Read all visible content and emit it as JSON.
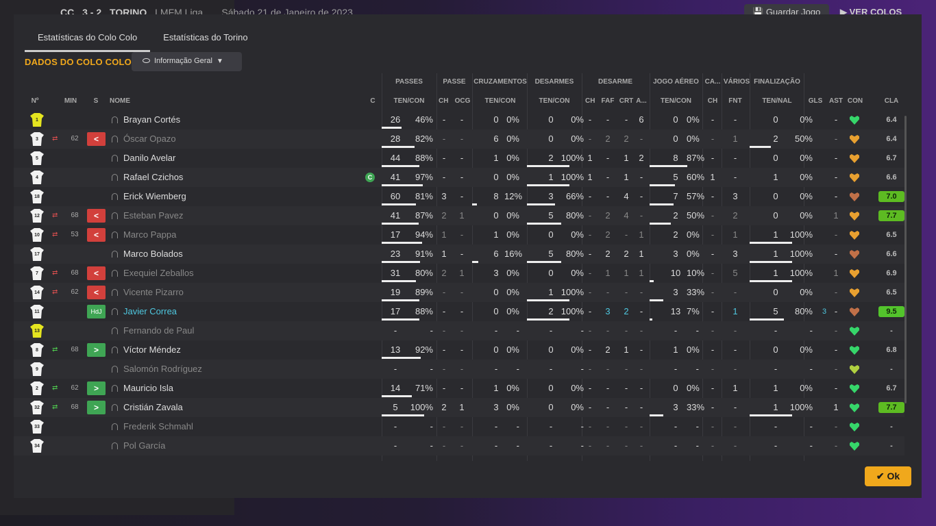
{
  "header": {
    "back_icon": "arrow-left-icon",
    "home_abbr": "CC",
    "score": "3 - 2",
    "away": "TORINO",
    "competition": "LMFM Liga",
    "date": "Sábado 21 de Janeiro de 2023",
    "save_label": "Guardar Jogo",
    "ver_label": "VER COLOS"
  },
  "tabs": [
    "Estatísticas do Colo Colo",
    "Estatísticas do Torino"
  ],
  "team_title": "DADOS DO COLO COLO",
  "dropdown": "Informação Geral",
  "groups": [
    "PASSES",
    "PASSE",
    "CRUZAMENTOS",
    "DESARMES",
    "DESARME",
    "JOGO AÉREO",
    "CA...",
    "VÁRIOS",
    "FINALIZAÇÃO"
  ],
  "columns": [
    "Nº",
    "MIN",
    "S",
    "NOME",
    "C",
    "TEN/CON",
    "CH",
    "OCG",
    "TEN/CON",
    "TEN/CON",
    "CH",
    "FAF",
    "CRT",
    "A...",
    "TEN/CON",
    "CH",
    "FNT",
    "TEN/NAL",
    "GLS",
    "AST",
    "CON",
    "CLA"
  ],
  "colors": {
    "accent": "#f0a81c",
    "sub_out": "#d2403c",
    "sub_in": "#3fa554",
    "link": "#4fc8e0"
  },
  "players": [
    {
      "name": "Brayan Cortés",
      "num": "1",
      "gk": true,
      "cap": false,
      "swap": "",
      "min": "",
      "s": "",
      "p": [
        "26",
        "46%"
      ],
      "p2": [
        "-",
        "-"
      ],
      "cr": [
        "0",
        "0%"
      ],
      "de": [
        "0",
        "0%"
      ],
      "d2": [
        "-",
        "-",
        "-",
        "6"
      ],
      "ae": [
        "0",
        "0%"
      ],
      "ca": "-",
      "fnt": "-",
      "fi": [
        "0",
        "0%"
      ],
      "gls": "",
      "ast": "-",
      "con": "#36d66a",
      "cla": "6.4",
      "hl": false,
      "dim": false,
      "bars": {
        "p": 37,
        "cr": 0,
        "de": 0,
        "ae": 0,
        "fi": 0
      }
    },
    {
      "name": "Óscar Opazo",
      "num": "3",
      "gk": false,
      "cap": false,
      "swap": "out",
      "min": "62",
      "s": "red",
      "p": [
        "28",
        "82%"
      ],
      "p2": [
        "-",
        "-"
      ],
      "cr": [
        "6",
        "0%"
      ],
      "de": [
        "0",
        "0%"
      ],
      "d2": [
        "-",
        "2",
        "2",
        "-"
      ],
      "ae": [
        "0",
        "0%"
      ],
      "ca": "-",
      "fnt": "1",
      "fi": [
        "2",
        "50%"
      ],
      "gls": "",
      "ast": "-",
      "con": "#e8a030",
      "cla": "6.4",
      "hl": false,
      "dim": true,
      "bars": {
        "p": 62,
        "cr": 0,
        "de": 0,
        "ae": 0,
        "fi": 40
      }
    },
    {
      "name": "Danilo Avelar",
      "num": "5",
      "gk": false,
      "cap": false,
      "swap": "",
      "min": "",
      "s": "",
      "p": [
        "44",
        "88%"
      ],
      "p2": [
        "-",
        "-"
      ],
      "cr": [
        "1",
        "0%"
      ],
      "de": [
        "2",
        "100%"
      ],
      "d2": [
        "1",
        "-",
        "1",
        "2"
      ],
      "ae": [
        "8",
        "87%"
      ],
      "ca": "-",
      "fnt": "-",
      "fi": [
        "0",
        "0%"
      ],
      "gls": "",
      "ast": "-",
      "con": "#e8a030",
      "cla": "6.7",
      "hl": false,
      "dim": false,
      "bars": {
        "p": 70,
        "cr": 0,
        "de": 80,
        "ae": 70,
        "fi": 0
      }
    },
    {
      "name": "Rafael Czichos",
      "num": "4",
      "gk": false,
      "cap": true,
      "swap": "",
      "min": "",
      "s": "",
      "p": [
        "41",
        "97%"
      ],
      "p2": [
        "-",
        "-"
      ],
      "cr": [
        "0",
        "0%"
      ],
      "de": [
        "1",
        "100%"
      ],
      "d2": [
        "1",
        "-",
        "1",
        "-"
      ],
      "ae": [
        "5",
        "60%"
      ],
      "ca": "1",
      "fnt": "-",
      "fi": [
        "1",
        "0%"
      ],
      "gls": "",
      "ast": "-",
      "con": "#e8a030",
      "cla": "6.6",
      "hl": false,
      "dim": false,
      "bars": {
        "p": 77,
        "cr": 0,
        "de": 80,
        "ae": 48,
        "fi": 0
      }
    },
    {
      "name": "Erick Wiemberg",
      "num": "18",
      "gk": false,
      "cap": false,
      "swap": "",
      "min": "",
      "s": "",
      "p": [
        "60",
        "81%"
      ],
      "p2": [
        "3",
        "-"
      ],
      "cr": [
        "8",
        "12%"
      ],
      "de": [
        "3",
        "66%"
      ],
      "d2": [
        "-",
        "-",
        "4",
        "-"
      ],
      "ae": [
        "7",
        "57%"
      ],
      "ca": "-",
      "fnt": "3",
      "fi": [
        "0",
        "0%"
      ],
      "gls": "",
      "ast": "-",
      "con": "#c07048",
      "cla": "7.0",
      "hl": true,
      "dim": false,
      "bars": {
        "p": 64,
        "cr": 9,
        "de": 52,
        "ae": 45,
        "fi": 0
      }
    },
    {
      "name": "Esteban Pavez",
      "num": "12",
      "gk": false,
      "cap": false,
      "swap": "out",
      "min": "68",
      "s": "red",
      "p": [
        "41",
        "87%"
      ],
      "p2": [
        "2",
        "1"
      ],
      "cr": [
        "0",
        "0%"
      ],
      "de": [
        "5",
        "80%"
      ],
      "d2": [
        "-",
        "2",
        "4",
        "-"
      ],
      "ae": [
        "2",
        "50%"
      ],
      "ca": "-",
      "fnt": "2",
      "fi": [
        "0",
        "0%"
      ],
      "gls": "",
      "ast": "1",
      "con": "#e8a030",
      "cla": "7.7",
      "hl": true,
      "dim": true,
      "bars": {
        "p": 69,
        "cr": 0,
        "de": 64,
        "ae": 40,
        "fi": 0
      }
    },
    {
      "name": "Marco Pappa",
      "num": "10",
      "gk": false,
      "cap": false,
      "swap": "out",
      "min": "53",
      "s": "red",
      "p": [
        "17",
        "94%"
      ],
      "p2": [
        "1",
        "-"
      ],
      "cr": [
        "1",
        "0%"
      ],
      "de": [
        "0",
        "0%"
      ],
      "d2": [
        "-",
        "2",
        "-",
        "1"
      ],
      "ae": [
        "2",
        "0%"
      ],
      "ca": "-",
      "fnt": "1",
      "fi": [
        "1",
        "100%"
      ],
      "gls": "",
      "ast": "-",
      "con": "#e8a030",
      "cla": "6.5",
      "hl": false,
      "dim": true,
      "bars": {
        "p": 75,
        "cr": 0,
        "de": 0,
        "ae": 0,
        "fi": 80
      }
    },
    {
      "name": "Marco Bolados",
      "num": "17",
      "gk": false,
      "cap": false,
      "swap": "",
      "min": "",
      "s": "",
      "p": [
        "23",
        "91%"
      ],
      "p2": [
        "1",
        "-"
      ],
      "cr": [
        "6",
        "16%"
      ],
      "de": [
        "5",
        "80%"
      ],
      "d2": [
        "-",
        "2",
        "2",
        "1"
      ],
      "ae": [
        "3",
        "0%"
      ],
      "ca": "-",
      "fnt": "3",
      "fi": [
        "1",
        "100%"
      ],
      "gls": "",
      "ast": "-",
      "con": "#c07048",
      "cla": "6.6",
      "hl": false,
      "dim": false,
      "bars": {
        "p": 72,
        "cr": 12,
        "de": 64,
        "ae": 0,
        "fi": 80
      }
    },
    {
      "name": "Exequiel Zeballos",
      "num": "7",
      "gk": false,
      "cap": false,
      "swap": "out",
      "min": "68",
      "s": "red",
      "p": [
        "31",
        "80%"
      ],
      "p2": [
        "2",
        "1"
      ],
      "cr": [
        "3",
        "0%"
      ],
      "de": [
        "0",
        "0%"
      ],
      "d2": [
        "-",
        "1",
        "1",
        "1"
      ],
      "ae": [
        "10",
        "10%"
      ],
      "ca": "-",
      "fnt": "5",
      "fi": [
        "1",
        "100%"
      ],
      "gls": "",
      "ast": "1",
      "con": "#e8a030",
      "cla": "6.9",
      "hl": false,
      "dim": true,
      "bars": {
        "p": 64,
        "cr": 0,
        "de": 0,
        "ae": 8,
        "fi": 80
      }
    },
    {
      "name": "Vicente Pizarro",
      "num": "14",
      "gk": false,
      "cap": false,
      "swap": "out",
      "min": "62",
      "s": "red",
      "p": [
        "19",
        "89%"
      ],
      "p2": [
        "-",
        "-"
      ],
      "cr": [
        "0",
        "0%"
      ],
      "de": [
        "1",
        "100%"
      ],
      "d2": [
        "-",
        "-",
        "-",
        "-"
      ],
      "ae": [
        "3",
        "33%"
      ],
      "ca": "-",
      "fnt": "-",
      "fi": [
        "0",
        "0%"
      ],
      "gls": "",
      "ast": "-",
      "con": "#e8a030",
      "cla": "6.5",
      "hl": false,
      "dim": true,
      "bars": {
        "p": 71,
        "cr": 0,
        "de": 80,
        "ae": 26,
        "fi": 0
      }
    },
    {
      "name": "Javier Correa",
      "num": "11",
      "gk": false,
      "cap": false,
      "swap": "",
      "min": "",
      "s": "hdj",
      "s_label": "HdJ",
      "p": [
        "17",
        "88%"
      ],
      "p2": [
        "-",
        "-"
      ],
      "cr": [
        "0",
        "0%"
      ],
      "de": [
        "2",
        "100%"
      ],
      "d2": [
        "-",
        "3",
        "2",
        "-"
      ],
      "ae": [
        "13",
        "7%"
      ],
      "ca": "-",
      "fnt": "1",
      "fi": [
        "5",
        "80%"
      ],
      "gls": "3",
      "ast": "-",
      "con": "#c07048",
      "cla": "9.5",
      "hl": true,
      "dim": false,
      "link": true,
      "bars": {
        "p": 70,
        "cr": 0,
        "de": 80,
        "ae": 5,
        "fi": 64
      }
    },
    {
      "name": "Fernando de Paul",
      "num": "13",
      "gk": true,
      "cap": false,
      "swap": "",
      "min": "",
      "s": "",
      "p": [
        "-",
        "-"
      ],
      "p2": [
        "-",
        "-"
      ],
      "cr": [
        "-",
        "-"
      ],
      "de": [
        "-",
        "-"
      ],
      "d2": [
        "-",
        "-",
        "-",
        "-"
      ],
      "ae": [
        "-",
        "-"
      ],
      "ca": "-",
      "fnt": "-",
      "fi": [
        "-",
        "-"
      ],
      "gls": "",
      "ast": "-",
      "con": "#36d66a",
      "cla": "-",
      "hl": false,
      "dim": true,
      "bars": {
        "p": 0,
        "cr": 0,
        "de": 0,
        "ae": 0,
        "fi": 0
      }
    },
    {
      "name": "Víctor Méndez",
      "num": "8",
      "gk": false,
      "cap": false,
      "swap": "in",
      "min": "68",
      "s": "green",
      "p": [
        "13",
        "92%"
      ],
      "p2": [
        "-",
        "-"
      ],
      "cr": [
        "0",
        "0%"
      ],
      "de": [
        "0",
        "0%"
      ],
      "d2": [
        "-",
        "2",
        "1",
        "-"
      ],
      "ae": [
        "1",
        "0%"
      ],
      "ca": "-",
      "fnt": "-",
      "fi": [
        "0",
        "0%"
      ],
      "gls": "",
      "ast": "-",
      "con": "#36d66a",
      "cla": "6.8",
      "hl": false,
      "dim": false,
      "bars": {
        "p": 73,
        "cr": 0,
        "de": 0,
        "ae": 0,
        "fi": 0
      }
    },
    {
      "name": "Salomón Rodríguez",
      "num": "9",
      "gk": false,
      "cap": false,
      "swap": "",
      "min": "",
      "s": "",
      "p": [
        "-",
        "-"
      ],
      "p2": [
        "-",
        "-"
      ],
      "cr": [
        "-",
        "-"
      ],
      "de": [
        "-",
        "-"
      ],
      "d2": [
        "-",
        "-",
        "-",
        "-"
      ],
      "ae": [
        "-",
        "-"
      ],
      "ca": "-",
      "fnt": "-",
      "fi": [
        "-",
        "-"
      ],
      "gls": "",
      "ast": "-",
      "con": "#b0d040",
      "cla": "-",
      "hl": false,
      "dim": true,
      "bars": {
        "p": 0,
        "cr": 0,
        "de": 0,
        "ae": 0,
        "fi": 0
      }
    },
    {
      "name": "Mauricio Isla",
      "num": "2",
      "gk": false,
      "cap": false,
      "swap": "in",
      "min": "62",
      "s": "green",
      "p": [
        "14",
        "71%"
      ],
      "p2": [
        "-",
        "-"
      ],
      "cr": [
        "1",
        "0%"
      ],
      "de": [
        "0",
        "0%"
      ],
      "d2": [
        "-",
        "-",
        "-",
        "-"
      ],
      "ae": [
        "0",
        "0%"
      ],
      "ca": "-",
      "fnt": "1",
      "fi": [
        "1",
        "0%"
      ],
      "gls": "",
      "ast": "-",
      "con": "#36d66a",
      "cla": "6.7",
      "hl": false,
      "dim": false,
      "bars": {
        "p": 57,
        "cr": 0,
        "de": 0,
        "ae": 0,
        "fi": 0
      }
    },
    {
      "name": "Cristián Zavala",
      "num": "32",
      "gk": false,
      "cap": false,
      "swap": "in",
      "min": "68",
      "s": "green",
      "p": [
        "5",
        "100%"
      ],
      "p2": [
        "2",
        "1"
      ],
      "cr": [
        "3",
        "0%"
      ],
      "de": [
        "0",
        "0%"
      ],
      "d2": [
        "-",
        "-",
        "-",
        "-"
      ],
      "ae": [
        "3",
        "33%"
      ],
      "ca": "-",
      "fnt": "-",
      "fi": [
        "1",
        "100%"
      ],
      "gls": "",
      "ast": "1",
      "con": "#36d66a",
      "cla": "7.7",
      "hl": true,
      "dim": false,
      "bars": {
        "p": 80,
        "cr": 0,
        "de": 0,
        "ae": 26,
        "fi": 80
      }
    },
    {
      "name": "Frederik Schmahl",
      "num": "33",
      "gk": false,
      "cap": false,
      "swap": "",
      "min": "",
      "s": "",
      "p": [
        "-",
        "-"
      ],
      "p2": [
        "-",
        "-"
      ],
      "cr": [
        "-",
        "-"
      ],
      "de": [
        "-",
        "-"
      ],
      "d2": [
        "-",
        "-",
        "-",
        "-"
      ],
      "ae": [
        "-",
        "-"
      ],
      "ca": "-",
      "fnt": "-",
      "fi": [
        "-",
        "-"
      ],
      "gls": "",
      "ast": "-",
      "con": "#36d66a",
      "cla": "-",
      "hl": false,
      "dim": true,
      "bars": {
        "p": 0,
        "cr": 0,
        "de": 0,
        "ae": 0,
        "fi": 0
      }
    },
    {
      "name": "Pol García",
      "num": "34",
      "gk": false,
      "cap": false,
      "swap": "",
      "min": "",
      "s": "",
      "p": [
        "-",
        "-"
      ],
      "p2": [
        "-",
        "-"
      ],
      "cr": [
        "-",
        "-"
      ],
      "de": [
        "-",
        "-"
      ],
      "d2": [
        "-",
        "-",
        "-",
        "-"
      ],
      "ae": [
        "-",
        "-"
      ],
      "ca": "-",
      "fnt": "-",
      "fi": [
        "-",
        "-"
      ],
      "gls": "",
      "ast": "-",
      "con": "#36d66a",
      "cla": "-",
      "hl": false,
      "dim": true,
      "bars": {
        "p": 0,
        "cr": 0,
        "de": 0,
        "ae": 0,
        "fi": 0
      }
    }
  ],
  "ok_label": "Ok"
}
